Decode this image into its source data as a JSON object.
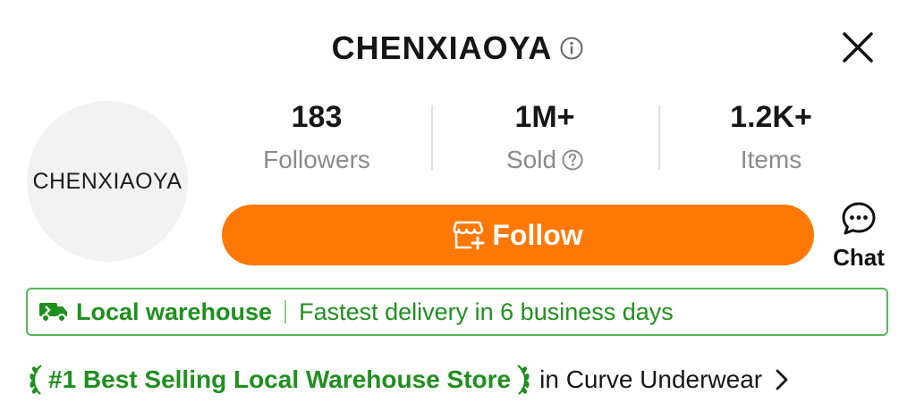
{
  "store": {
    "name": "CHENXIAOYA",
    "avatar_text": "CHENXIAOYA"
  },
  "stats": [
    {
      "value": "183",
      "label": "Followers"
    },
    {
      "value": "1M+",
      "label": "Sold"
    },
    {
      "value": "1.2K+",
      "label": "Items"
    }
  ],
  "actions": {
    "follow_label": "Follow",
    "chat_label": "Chat"
  },
  "banner": {
    "main": "Local warehouse",
    "sub": "Fastest delivery in 6 business days"
  },
  "ranking": {
    "title": "#1 Best Selling Local Warehouse Store",
    "category": "in Curve Underwear"
  },
  "colors": {
    "accent": "#fd7805",
    "green": "#1f8f1f",
    "muted": "#8a8a8a"
  },
  "icons": [
    "info-icon",
    "close-icon",
    "help-icon",
    "store-follow-icon",
    "chat-bubble-icon",
    "truck-icon",
    "laurel-icon",
    "chevron-right-icon"
  ]
}
